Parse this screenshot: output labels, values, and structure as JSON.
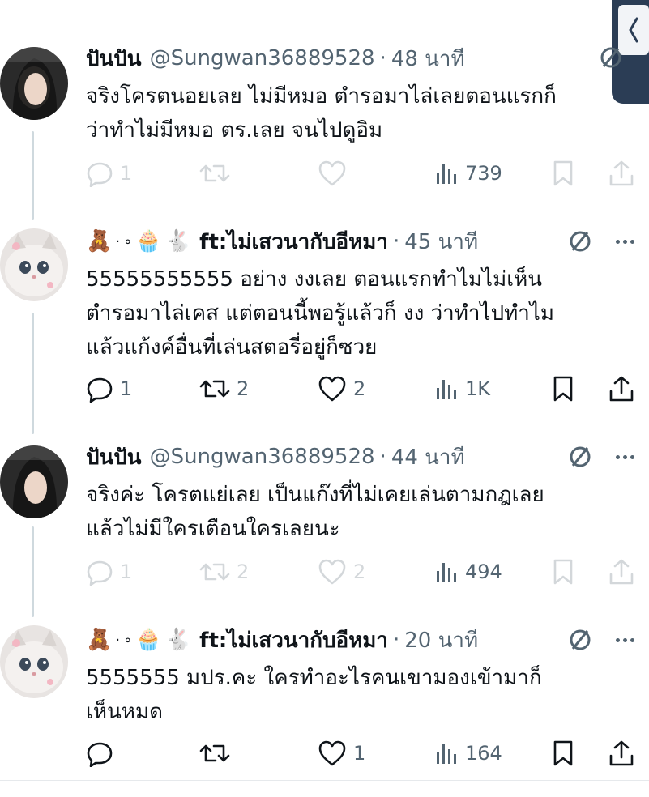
{
  "tweets": [
    {
      "name": "ปันปัน",
      "handle": "@Sungwan36889528",
      "dot": "·",
      "time": "48 นาที",
      "lines": [
        "จริงโครตนอยเลย ไม่มีหมอ ตำรอมาไล่เลยตอนแรกก็",
        "ว่าทำไม่มีหมอ ตร.เลย จนไปดูอิม"
      ],
      "reply_count": "1",
      "retweet_count": "",
      "like_count": "",
      "views": "739",
      "faded": true
    },
    {
      "name": "ft:ไม่เสวนากับอีหมา",
      "emojis": [
        "🧸",
        "·",
        "∘",
        "🧁",
        "🐇"
      ],
      "dot": "·",
      "time": "45 นาที",
      "lines": [
        "55555555555 อย่าง งงเลย ตอนแรกทำไมไม่เห็น",
        "ตำรอมาไล่เคส แต่ตอนนี้พอรู้แล้วก็ งง ว่าทำไปทำไม",
        "แล้วแก้งค์อื่นที่เล่นสตอรี่อยู่ก็ซวย"
      ],
      "reply_count": "1",
      "retweet_count": "2",
      "like_count": "2",
      "views": "1K",
      "faded": false
    },
    {
      "name": "ปันปัน",
      "handle": "@Sungwan36889528",
      "dot": "·",
      "time": "44 นาที",
      "lines": [
        "จริงค่ะ โครตแย่เลย เป็นแก๊งที่ไม่เคยเล่นตามกฎเลย",
        "แล้วไม่มีใครเตือนใครเลยนะ"
      ],
      "reply_count": "1",
      "retweet_count": "2",
      "like_count": "2",
      "views": "494",
      "faded": true
    },
    {
      "name": "ft:ไม่เสวนากับอีหมา",
      "emojis": [
        "🧸",
        "·",
        "∘",
        "🧁",
        "🐇"
      ],
      "dot": "·",
      "time": "20 นาที",
      "lines": [
        "5555555 มปร.คะ ใครทำอะไรคนเขามองเข้ามาก็",
        "เห็นหมด"
      ],
      "reply_count": "",
      "retweet_count": "",
      "like_count": "1",
      "views": "164",
      "faded": false
    }
  ],
  "icons": {
    "reply": "reply-icon",
    "retweet": "retweet-icon",
    "like": "heart-icon",
    "views": "views-icon",
    "bookmark": "bookmark-icon",
    "share": "share-icon",
    "grok": "grok-slash-icon",
    "more": "more-icon",
    "side_tab": "chevron-left-icon"
  },
  "colors": {
    "text": "#0f1419",
    "muted": "#536471",
    "thread_line": "#cfd9de",
    "side_tab": "#2b3d55"
  }
}
